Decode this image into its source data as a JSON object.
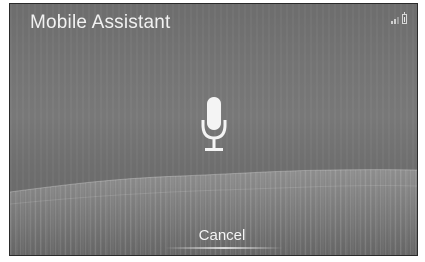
{
  "header": {
    "title": "Mobile Assistant",
    "signal_icon": "signal-strength-icon",
    "battery_icon": "battery-icon"
  },
  "main": {
    "mic_icon": "microphone-icon"
  },
  "footer": {
    "cancel_label": "Cancel"
  },
  "colors": {
    "background": "#737373",
    "text": "#f2f2f2"
  }
}
